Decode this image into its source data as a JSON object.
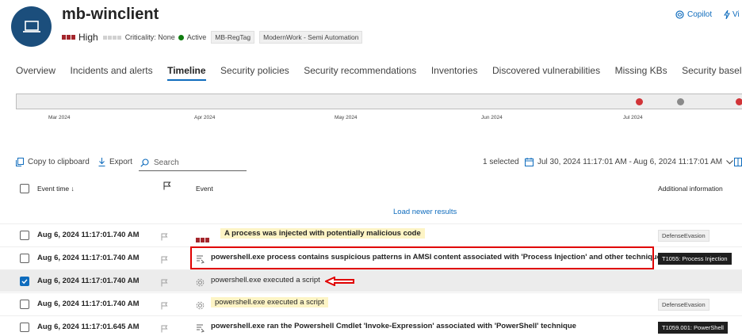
{
  "device": {
    "name": "mb-winclient",
    "risk_label": "High",
    "criticality": "Criticality: None",
    "status": "Active",
    "tags": [
      "MB-RegTag",
      "ModernWork - Semi Automation"
    ]
  },
  "header_actions": {
    "copilot": "Copilot",
    "vi": "Vi"
  },
  "tabs": [
    {
      "label": "Overview"
    },
    {
      "label": "Incidents and alerts"
    },
    {
      "label": "Timeline",
      "active": true
    },
    {
      "label": "Security policies"
    },
    {
      "label": "Security recommendations"
    },
    {
      "label": "Inventories"
    },
    {
      "label": "Discovered vulnerabilities"
    },
    {
      "label": "Missing KBs"
    },
    {
      "label": "Security baselines"
    }
  ],
  "timeline": {
    "months": [
      "Mar 2024",
      "Apr 2024",
      "May 2024",
      "Jun 2024",
      "Jul 2024"
    ]
  },
  "toolbar": {
    "copy": "Copy to clipboard",
    "export": "Export",
    "search_placeholder": "Search",
    "selected": "1 selected",
    "date_range": "Jul 30, 2024 11:17:01 AM - Aug 6, 2024 11:17:01 AM"
  },
  "table": {
    "col_time": "Event time",
    "col_event": "Event",
    "col_info": "Additional information",
    "load_newer": "Load newer results",
    "rows": [
      {
        "time": "Aug 6, 2024 11:17:01.740 AM",
        "event": "A process was injected with potentially malicious code",
        "info": "DefenseEvasion"
      },
      {
        "time": "Aug 6, 2024 11:17:01.740 AM",
        "event": "powershell.exe process contains suspicious patterns in AMSI content associated with 'Process Injection' and other techniques",
        "info": "T1055: Process Injection"
      },
      {
        "time": "Aug 6, 2024 11:17:01.740 AM",
        "event": "powershell.exe executed a script",
        "info": ""
      },
      {
        "time": "Aug 6, 2024 11:17:01.740 AM",
        "event": "powershell.exe executed a script",
        "info": "DefenseEvasion"
      },
      {
        "time": "Aug 6, 2024 11:17:01.645 AM",
        "event": "powershell.exe ran the Powershell Cmdlet 'Invoke-Expression' associated with 'PowerShell' technique",
        "info": "T1059.001: PowerShell"
      }
    ]
  },
  "colors": {
    "accent": "#0f6cbd",
    "risk_high": "#a4262c",
    "alert_dot": "#d13438",
    "annotation": "#e00000"
  }
}
